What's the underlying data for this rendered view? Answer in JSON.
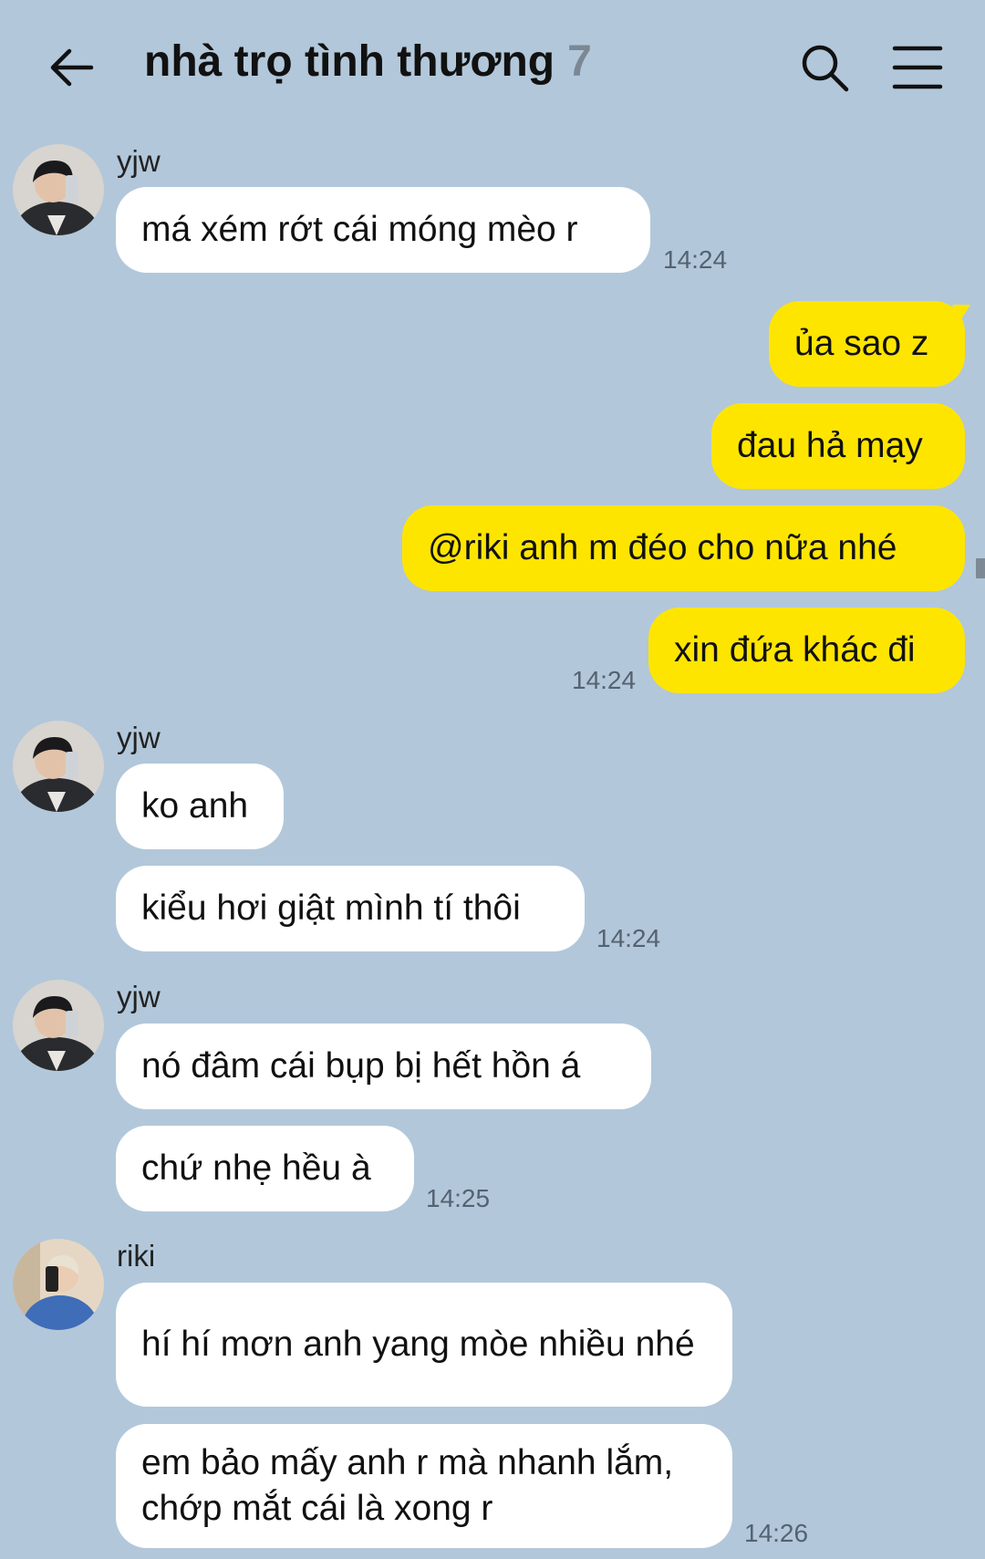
{
  "header": {
    "title": "nhà trọ tình thương",
    "member_count": "7",
    "icons": [
      "back-arrow-icon",
      "search-icon",
      "menu-icon"
    ]
  },
  "colors": {
    "background": "#b2c7da",
    "mine_bubble": "#fee500",
    "other_bubble": "#ffffff"
  },
  "groups": [
    {
      "sender": "yjw",
      "time": "14:24",
      "messages": [
        "má xém rớt cái móng mèo r"
      ]
    },
    {
      "sender": "me",
      "time": "14:24",
      "messages": [
        "ủa sao z",
        "đau hả mạy",
        "@riki anh m đéo cho nữa nhé",
        "xin đứa khác đi"
      ]
    },
    {
      "sender": "yjw",
      "time": "14:24",
      "messages": [
        "ko anh",
        "kiểu hơi giật mình tí thôi"
      ]
    },
    {
      "sender": "yjw",
      "time": "14:25",
      "messages": [
        "nó đâm cái bụp bị hết hồn á",
        "chứ nhẹ hều à"
      ]
    },
    {
      "sender": "riki",
      "time": "14:26",
      "messages": [
        "hí hí mơn anh yang mòe nhiều nhé",
        "em bảo mấy anh r mà nhanh lắm, chớp mắt cái là xong r"
      ]
    }
  ]
}
